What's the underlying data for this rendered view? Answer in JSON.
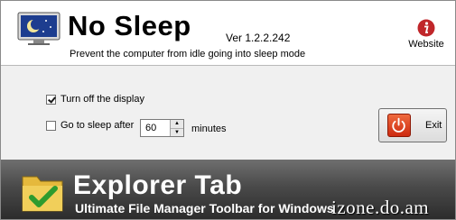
{
  "header": {
    "title": "No Sleep",
    "version": "Ver 1.2.2.242",
    "tagline": "Prevent the computer from idle going into sleep mode",
    "website_label": "Website",
    "website_icon": "info-icon",
    "app_icon": "moon-monitor-icon"
  },
  "options": {
    "turn_off_display": {
      "label": "Turn off the display",
      "checked": true
    },
    "sleep_after": {
      "label": "Go to sleep after",
      "checked": false,
      "value": "60",
      "unit": "minutes"
    }
  },
  "exit_button": {
    "label": "Exit",
    "icon": "power-icon"
  },
  "banner": {
    "title": "Explorer Tab",
    "subtitle": "Ultimate File Manager Toolbar for Windows",
    "icon": "folder-check-icon",
    "watermark": "izone.do.am"
  },
  "colors": {
    "exit_red": "#d9361a",
    "website_red": "#c0262a",
    "banner_dark": "#2c2c2c"
  }
}
